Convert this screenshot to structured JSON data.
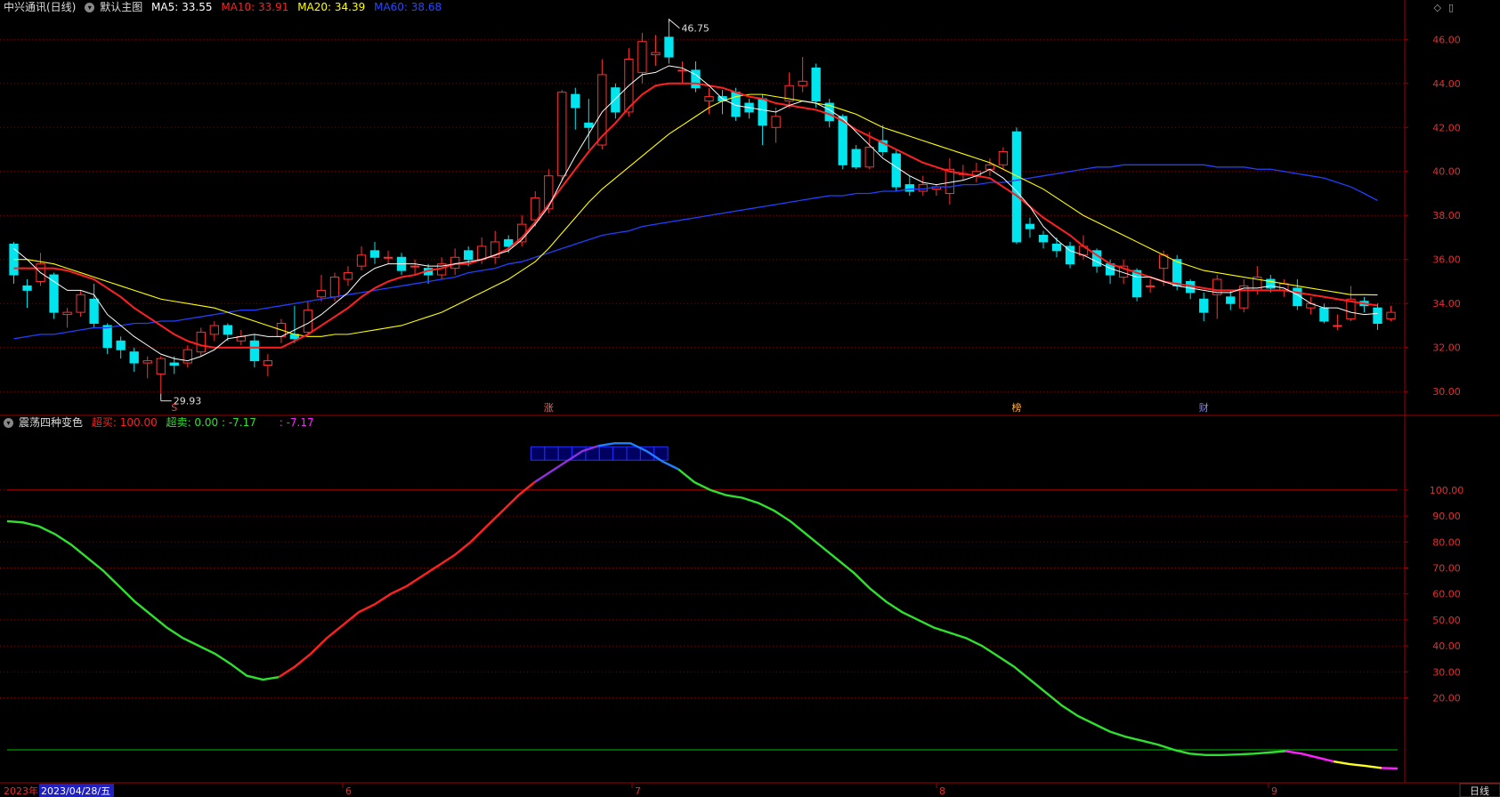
{
  "header": {
    "stock_name": "中兴通讯(日线)",
    "main_chart_label": "默认主图",
    "ma5": {
      "label": "MA5:",
      "value": "33.55",
      "color": "#ffffff"
    },
    "ma10": {
      "label": "MA10:",
      "value": "33.91",
      "color": "#ff2020"
    },
    "ma20": {
      "label": "MA20:",
      "value": "34.39",
      "color": "#ffff00"
    },
    "ma60": {
      "label": "MA60:",
      "value": "38.68",
      "color": "#2040ff"
    }
  },
  "indicator_header": {
    "name": "震荡四种变色",
    "overbought_label": "超买:",
    "overbought_value": "100.00",
    "oversold_label": "超卖:",
    "oversold_value": "0.00",
    "value_1": "-7.17",
    "value_2_prefix": ":",
    "value_2": "-7.17"
  },
  "bottom_bar": {
    "year_label": "2023年",
    "cursor_date": "2023/04/28/五",
    "month_labels": [
      "6",
      "7",
      "8",
      "9"
    ],
    "period_button": "日线"
  },
  "top_right_icons": [
    "diamond-icon",
    "window-icon"
  ],
  "event_markers": [
    "S",
    "涨",
    "榜",
    "财"
  ],
  "chart_data": [
    {
      "type": "candlestick",
      "title": "中兴通讯(日线)",
      "y_tick_labels": [
        "46.00",
        "44.00",
        "42.00",
        "40.00",
        "38.00",
        "36.00",
        "34.00",
        "32.00",
        "30.00"
      ],
      "ylim": [
        29.2,
        46.9
      ],
      "annotations": {
        "high": "46.75",
        "low": "29.93"
      },
      "up_color": "#ff3030",
      "down_color": "#00e5ee",
      "candles": [
        [
          36.7,
          35.3,
          36.8,
          34.9
        ],
        [
          34.8,
          34.6,
          35.1,
          33.8
        ],
        [
          35.0,
          35.8,
          36.3,
          34.8
        ],
        [
          35.3,
          33.6,
          35.4,
          33.3
        ],
        [
          33.5,
          33.6,
          33.8,
          32.9
        ],
        [
          33.6,
          34.4,
          34.6,
          33.4
        ],
        [
          34.2,
          33.1,
          34.9,
          32.9
        ],
        [
          33.0,
          32.0,
          33.1,
          31.7
        ],
        [
          32.3,
          31.9,
          32.5,
          31.5
        ],
        [
          31.8,
          31.3,
          32.0,
          30.9
        ],
        [
          31.3,
          31.4,
          31.6,
          30.6
        ],
        [
          30.8,
          31.5,
          31.6,
          29.9
        ],
        [
          31.3,
          31.2,
          31.6,
          30.8
        ],
        [
          31.3,
          31.9,
          32.1,
          31.1
        ],
        [
          31.8,
          32.7,
          32.9,
          31.6
        ],
        [
          32.6,
          33.0,
          33.2,
          32.3
        ],
        [
          33.0,
          32.6,
          33.1,
          32.3
        ],
        [
          32.3,
          32.5,
          32.8,
          32.1
        ],
        [
          32.3,
          31.4,
          32.6,
          31.1
        ],
        [
          31.2,
          31.4,
          31.7,
          30.7
        ],
        [
          32.5,
          33.1,
          33.3,
          32.2
        ],
        [
          32.6,
          32.4,
          33.9,
          32.2
        ],
        [
          32.7,
          33.7,
          34.1,
          32.6
        ],
        [
          34.3,
          34.6,
          35.3,
          34.1
        ],
        [
          34.3,
          35.2,
          35.4,
          34.1
        ],
        [
          35.1,
          35.4,
          35.7,
          34.8
        ],
        [
          35.7,
          36.2,
          36.6,
          35.5
        ],
        [
          36.4,
          36.1,
          36.8,
          35.8
        ],
        [
          36.1,
          36.1,
          36.4,
          35.8
        ],
        [
          36.1,
          35.5,
          36.3,
          35.3
        ],
        [
          35.7,
          35.7,
          36.0,
          35.3
        ],
        [
          35.6,
          35.3,
          35.8,
          34.9
        ],
        [
          35.3,
          35.8,
          36.1,
          35.1
        ],
        [
          35.6,
          36.1,
          36.5,
          35.3
        ],
        [
          36.4,
          36.0,
          36.6,
          35.7
        ],
        [
          36.0,
          36.6,
          37.0,
          35.8
        ],
        [
          36.1,
          36.8,
          37.3,
          35.8
        ],
        [
          36.9,
          36.6,
          37.1,
          36.3
        ],
        [
          36.8,
          37.6,
          38.0,
          36.6
        ],
        [
          37.8,
          38.8,
          39.1,
          37.5
        ],
        [
          38.3,
          39.8,
          40.1,
          38.1
        ],
        [
          39.8,
          43.6,
          43.7,
          39.6
        ],
        [
          43.5,
          42.9,
          43.8,
          41.9
        ],
        [
          42.2,
          42.0,
          43.3,
          41.0
        ],
        [
          41.2,
          44.4,
          45.1,
          41.0
        ],
        [
          43.8,
          42.7,
          44.0,
          42.4
        ],
        [
          42.7,
          45.1,
          45.6,
          42.5
        ],
        [
          44.5,
          45.9,
          46.3,
          44.0
        ],
        [
          45.3,
          45.4,
          46.2,
          44.8
        ],
        [
          46.1,
          45.2,
          46.75,
          44.9
        ],
        [
          44.6,
          44.6,
          45.0,
          44.0
        ],
        [
          44.6,
          43.8,
          45.0,
          43.6
        ],
        [
          43.2,
          43.4,
          43.8,
          42.6
        ],
        [
          43.4,
          43.2,
          43.7,
          42.6
        ],
        [
          43.6,
          42.5,
          43.8,
          42.3
        ],
        [
          43.1,
          42.7,
          43.3,
          42.4
        ],
        [
          43.3,
          42.1,
          43.5,
          41.2
        ],
        [
          42.0,
          42.5,
          42.9,
          41.3
        ],
        [
          43.2,
          43.9,
          44.5,
          42.9
        ],
        [
          43.9,
          44.1,
          45.2,
          43.6
        ],
        [
          44.7,
          43.2,
          44.9,
          42.9
        ],
        [
          43.1,
          42.3,
          43.3,
          42.0
        ],
        [
          42.5,
          40.3,
          42.6,
          40.1
        ],
        [
          41.0,
          40.2,
          41.2,
          40.1
        ],
        [
          40.2,
          41.1,
          41.8,
          40.1
        ],
        [
          41.4,
          40.9,
          42.1,
          40.7
        ],
        [
          40.8,
          39.3,
          41.0,
          39.1
        ],
        [
          39.4,
          39.1,
          39.8,
          38.9
        ],
        [
          39.1,
          39.4,
          39.8,
          38.9
        ],
        [
          39.2,
          39.3,
          39.4,
          38.9
        ],
        [
          39.0,
          40.1,
          40.6,
          38.5
        ],
        [
          39.9,
          39.9,
          40.3,
          39.6
        ],
        [
          39.8,
          40.0,
          40.4,
          39.5
        ],
        [
          40.1,
          40.3,
          40.6,
          39.8
        ],
        [
          40.3,
          40.9,
          41.1,
          40.1
        ],
        [
          41.8,
          36.8,
          42.0,
          36.7
        ],
        [
          37.6,
          37.4,
          37.9,
          37.0
        ],
        [
          37.1,
          36.8,
          37.3,
          36.5
        ],
        [
          36.7,
          36.4,
          37.0,
          36.1
        ],
        [
          36.6,
          35.8,
          36.8,
          35.6
        ],
        [
          36.2,
          36.6,
          37.1,
          36.0
        ],
        [
          36.4,
          35.7,
          36.5,
          35.4
        ],
        [
          35.8,
          35.3,
          36.0,
          34.9
        ],
        [
          35.2,
          35.7,
          36.0,
          34.9
        ],
        [
          35.5,
          34.3,
          35.6,
          34.1
        ],
        [
          34.8,
          34.8,
          35.1,
          34.5
        ],
        [
          35.6,
          36.2,
          36.4,
          34.8
        ],
        [
          36.0,
          34.8,
          36.2,
          34.6
        ],
        [
          35.0,
          34.5,
          35.1,
          34.2
        ],
        [
          34.2,
          33.6,
          34.5,
          33.2
        ],
        [
          34.4,
          35.1,
          35.3,
          33.3
        ],
        [
          34.3,
          34.0,
          34.6,
          33.7
        ],
        [
          33.8,
          34.8,
          35.1,
          33.6
        ],
        [
          34.6,
          35.2,
          35.7,
          34.4
        ],
        [
          35.1,
          34.7,
          35.3,
          34.5
        ],
        [
          34.6,
          34.9,
          35.1,
          34.3
        ],
        [
          34.7,
          33.9,
          35.1,
          33.7
        ],
        [
          33.8,
          34.0,
          34.3,
          33.5
        ],
        [
          33.8,
          33.2,
          34.0,
          33.1
        ],
        [
          33.0,
          33.0,
          33.5,
          32.8
        ],
        [
          33.3,
          34.2,
          34.8,
          33.2
        ],
        [
          34.1,
          33.9,
          34.3,
          33.6
        ],
        [
          33.8,
          33.1,
          34.0,
          32.8
        ],
        [
          33.3,
          33.6,
          33.9,
          33.2
        ]
      ],
      "ma5": [
        36.5,
        36.0,
        35.4,
        35.0,
        34.6,
        34.6,
        34.4,
        33.5,
        33.0,
        32.5,
        32.1,
        31.7,
        31.5,
        31.4,
        31.6,
        31.9,
        32.4,
        32.5,
        32.6,
        32.5,
        32.5,
        32.8,
        33.1,
        33.5,
        34.0,
        34.5,
        35.2,
        35.6,
        35.8,
        35.8,
        35.8,
        35.7,
        35.7,
        35.8,
        35.9,
        36.0,
        36.2,
        36.4,
        36.9,
        37.6,
        38.4,
        39.6,
        40.7,
        41.7,
        42.7,
        43.3,
        43.9,
        44.4,
        44.5,
        44.8,
        44.7,
        44.4,
        43.9,
        43.3,
        43.0,
        42.9,
        42.8,
        42.7,
        43.0,
        43.2,
        43.1,
        42.8,
        42.4,
        41.8,
        41.2,
        40.6,
        40.2,
        39.8,
        39.5,
        39.4,
        39.5,
        39.6,
        39.8,
        40.1,
        39.7,
        39.1,
        38.4,
        37.5,
        36.9,
        36.4,
        36.2,
        35.9,
        35.6,
        35.4,
        35.2,
        35.2,
        35.0,
        34.8,
        34.7,
        34.6,
        34.5,
        34.5,
        34.7,
        34.7,
        34.8,
        34.7,
        34.4,
        34.0,
        33.8,
        33.8,
        33.6,
        33.5,
        33.55
      ],
      "ma10": [
        35.6,
        35.6,
        35.6,
        35.6,
        35.5,
        35.3,
        35.1,
        34.7,
        34.3,
        33.8,
        33.4,
        33.0,
        32.6,
        32.3,
        32.1,
        32.0,
        32.0,
        32.0,
        32.0,
        32.0,
        32.0,
        32.3,
        32.6,
        33.0,
        33.4,
        33.8,
        34.3,
        34.7,
        35.0,
        35.2,
        35.3,
        35.5,
        35.6,
        35.8,
        35.8,
        36.0,
        36.2,
        36.5,
        37.0,
        37.7,
        38.5,
        39.3,
        40.1,
        40.9,
        41.6,
        42.2,
        42.9,
        43.5,
        43.9,
        44.0,
        44.0,
        44.0,
        43.9,
        43.8,
        43.6,
        43.4,
        43.3,
        43.1,
        43.0,
        42.9,
        42.8,
        42.6,
        42.3,
        41.9,
        41.6,
        41.3,
        41.0,
        40.7,
        40.4,
        40.2,
        40.0,
        39.9,
        39.8,
        39.7,
        39.3,
        38.9,
        38.4,
        37.9,
        37.5,
        37.1,
        36.6,
        36.2,
        35.8,
        35.6,
        35.4,
        35.2,
        35.0,
        34.9,
        34.8,
        34.7,
        34.6,
        34.6,
        34.6,
        34.6,
        34.6,
        34.6,
        34.5,
        34.4,
        34.3,
        34.2,
        34.1,
        34.0,
        33.91
      ],
      "ma20": [
        36.0,
        36.0,
        35.9,
        35.8,
        35.6,
        35.4,
        35.2,
        35.0,
        34.8,
        34.6,
        34.4,
        34.2,
        34.1,
        34.0,
        33.9,
        33.8,
        33.6,
        33.4,
        33.2,
        33.0,
        32.8,
        32.6,
        32.5,
        32.5,
        32.6,
        32.6,
        32.7,
        32.8,
        32.9,
        33.0,
        33.2,
        33.4,
        33.6,
        33.9,
        34.2,
        34.5,
        34.8,
        35.1,
        35.5,
        35.9,
        36.5,
        37.2,
        37.9,
        38.6,
        39.2,
        39.7,
        40.2,
        40.7,
        41.2,
        41.7,
        42.1,
        42.5,
        42.9,
        43.2,
        43.4,
        43.5,
        43.5,
        43.4,
        43.3,
        43.2,
        43.1,
        43.0,
        42.8,
        42.6,
        42.3,
        42.0,
        41.8,
        41.6,
        41.4,
        41.2,
        41.0,
        40.8,
        40.6,
        40.4,
        40.1,
        39.8,
        39.5,
        39.2,
        38.8,
        38.4,
        38.0,
        37.7,
        37.4,
        37.1,
        36.8,
        36.5,
        36.2,
        35.9,
        35.7,
        35.5,
        35.4,
        35.3,
        35.2,
        35.1,
        35.0,
        34.9,
        34.8,
        34.7,
        34.6,
        34.5,
        34.4,
        34.4,
        34.39
      ],
      "ma60": [
        32.4,
        32.5,
        32.6,
        32.6,
        32.7,
        32.8,
        32.9,
        32.9,
        33.0,
        33.1,
        33.1,
        33.2,
        33.2,
        33.3,
        33.4,
        33.5,
        33.6,
        33.7,
        33.7,
        33.8,
        33.9,
        34.0,
        34.1,
        34.2,
        34.3,
        34.4,
        34.5,
        34.6,
        34.7,
        34.8,
        34.9,
        35.0,
        35.1,
        35.2,
        35.4,
        35.5,
        35.6,
        35.8,
        35.9,
        36.1,
        36.3,
        36.5,
        36.7,
        36.9,
        37.1,
        37.2,
        37.3,
        37.5,
        37.6,
        37.7,
        37.8,
        37.9,
        38.0,
        38.1,
        38.2,
        38.3,
        38.4,
        38.5,
        38.6,
        38.7,
        38.8,
        38.9,
        38.9,
        39.0,
        39.0,
        39.1,
        39.1,
        39.2,
        39.2,
        39.3,
        39.3,
        39.4,
        39.4,
        39.5,
        39.5,
        39.6,
        39.7,
        39.8,
        39.9,
        40.0,
        40.1,
        40.2,
        40.2,
        40.3,
        40.3,
        40.3,
        40.3,
        40.3,
        40.3,
        40.3,
        40.2,
        40.2,
        40.2,
        40.1,
        40.1,
        40.0,
        39.9,
        39.8,
        39.7,
        39.5,
        39.3,
        39.0,
        38.68
      ]
    },
    {
      "type": "line",
      "title": "震荡四种变色",
      "y_tick_labels": [
        "100.00",
        "90.00",
        "80.00",
        "70.00",
        "60.00",
        "50.00",
        "40.00",
        "30.00",
        "20.00"
      ],
      "ylim": [
        -12,
        127
      ],
      "reference_lines": [
        {
          "value": 100,
          "color": "#c00000"
        },
        {
          "value": 0,
          "color": "#00c000"
        }
      ],
      "overbought_bar_cells": 10,
      "values": [
        88,
        87.5,
        86,
        83,
        79,
        74,
        69,
        63,
        57,
        52,
        47,
        43,
        40,
        37,
        33,
        28.5,
        27,
        28,
        32,
        37,
        43,
        48,
        53,
        56,
        60,
        63,
        67,
        71,
        75,
        80,
        86,
        92,
        98,
        103,
        107,
        111,
        115,
        117,
        118,
        118,
        115,
        111,
        108,
        103,
        100,
        98,
        97,
        95,
        92,
        88,
        83,
        78,
        73,
        68,
        62,
        57,
        53,
        50,
        47,
        45,
        43,
        40,
        36,
        32,
        27,
        22,
        17,
        13,
        10,
        7,
        5,
        3.5,
        2,
        0,
        -1.5,
        -2,
        -2,
        -1.8,
        -1.5,
        -1,
        -0.5,
        -1.5,
        -3,
        -4.5,
        -5.5,
        -6.2,
        -7,
        -7.17
      ],
      "segment_colors": [
        "#30e030",
        "#ff2020",
        "#ff2020",
        "#9030e0",
        "#2080ff",
        "#30e030",
        "#ff20ff",
        "#ffff20",
        "#ff20ff"
      ]
    }
  ]
}
